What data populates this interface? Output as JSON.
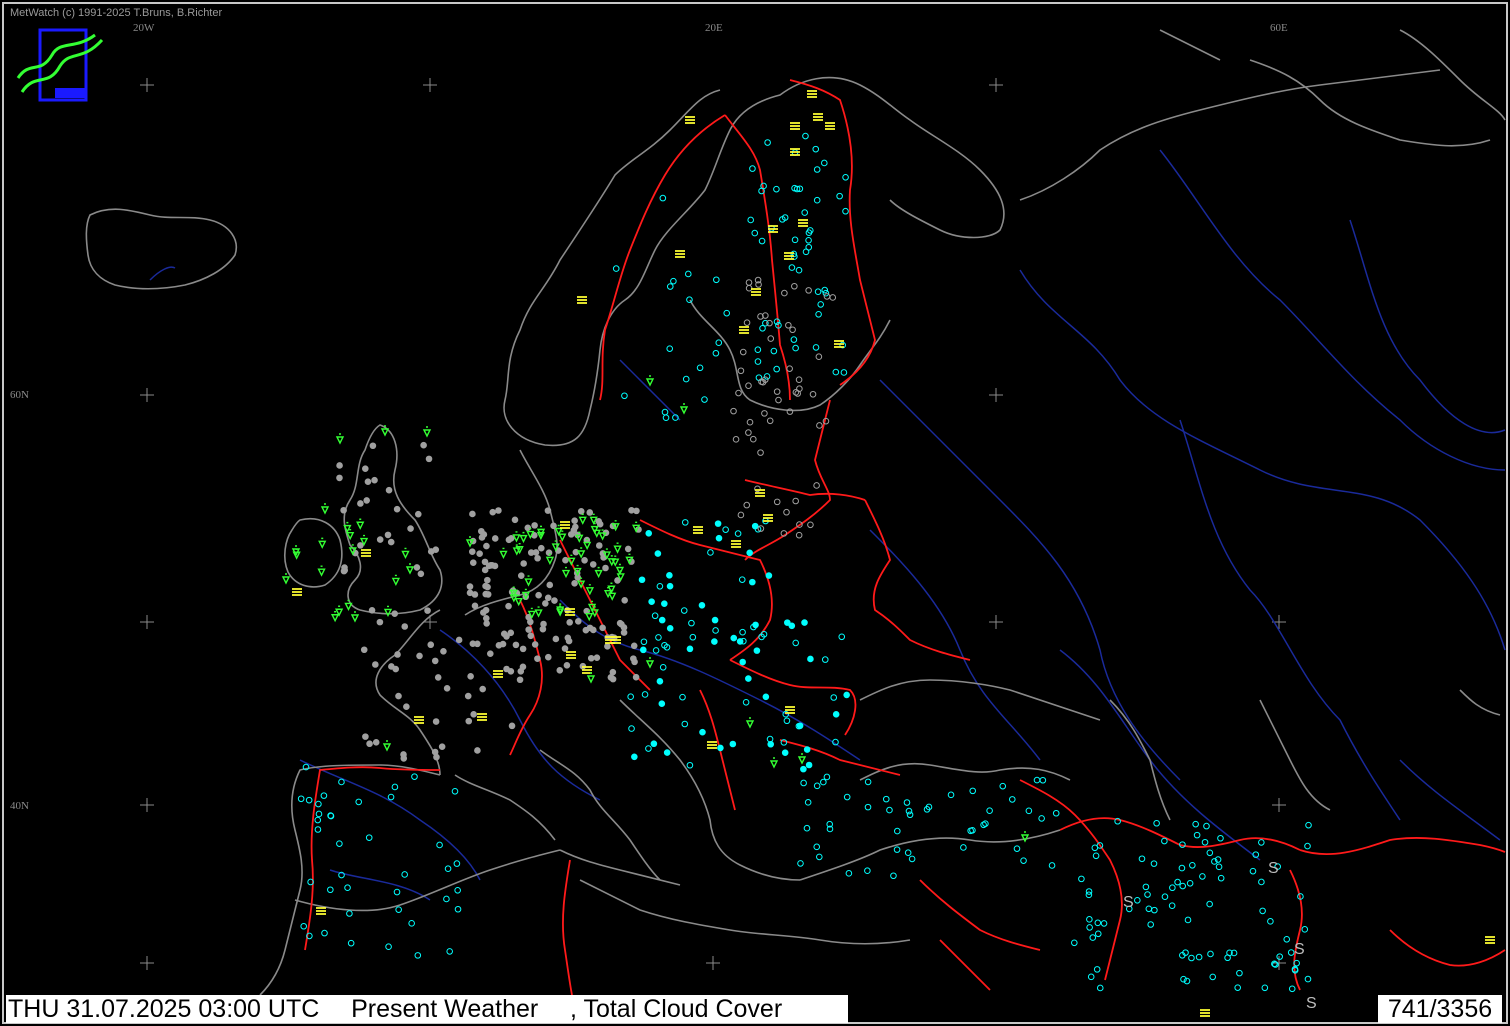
{
  "app": {
    "copyright": "MetWatch  (c) 1991-2025 T.Bruns, B.Richter"
  },
  "grid": {
    "lon_labels": [
      "20W",
      "20E",
      "60E"
    ],
    "lat_labels": [
      "60N",
      "40N"
    ]
  },
  "status_bar": {
    "datetime": "THU 31.07.2025 03:00 UTC",
    "parameter_1": "Present Weather",
    "parameter_2": ", Total Cloud Cover",
    "station_count": "741/3356"
  },
  "symbols": {
    "letter_s": "S"
  },
  "colors": {
    "background": "#000000",
    "coastline": "#8a8a8a",
    "border": "#ff1a1a",
    "river": "#1a2a9a",
    "cloud_clear": "#00ffff",
    "cloud_overcast": "#a0a0a0",
    "fog": "#ffff33",
    "rain": "#33ff33",
    "logo": "#33ff33",
    "logo_frame": "#1a1aff"
  }
}
